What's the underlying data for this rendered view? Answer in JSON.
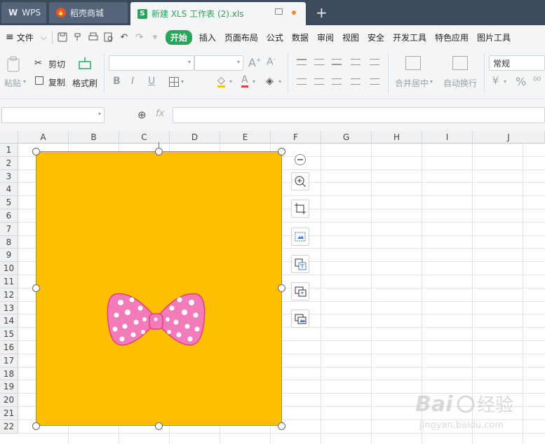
{
  "tabs": {
    "wps": "WPS",
    "shop": "稻壳商城",
    "doc": "新建 XLS 工作表 (2).xls",
    "new_tab": "+"
  },
  "menu": {
    "file": "文件",
    "items": [
      "开始",
      "插入",
      "页面布局",
      "公式",
      "数据",
      "审阅",
      "视图",
      "安全",
      "开发工具",
      "特色应用",
      "图片工具"
    ]
  },
  "ribbon": {
    "paste": "粘贴",
    "cut": "剪切",
    "copy": "复制",
    "format_painter": "格式刷",
    "bold": "B",
    "italic": "I",
    "underline": "U",
    "merge_center": "合并居中",
    "auto_wrap": "自动换行",
    "number_format": "常规",
    "percent": "%"
  },
  "formula_bar": {
    "fx": "fx",
    "name_box": "",
    "formula": ""
  },
  "sheet": {
    "columns": [
      "A",
      "B",
      "C",
      "D",
      "E",
      "F",
      "G",
      "H",
      "I",
      "J"
    ],
    "rows": [
      "1",
      "2",
      "3",
      "4",
      "5",
      "6",
      "7",
      "8",
      "9",
      "10",
      "11",
      "12",
      "13",
      "14",
      "15",
      "16",
      "17",
      "18",
      "19",
      "20",
      "21",
      "22"
    ]
  },
  "picture": {
    "background_color": "#ffbf00",
    "bow_color": "#f47bb9",
    "bow_outline": "#e0407f"
  },
  "side_tools": [
    "zoom-out-icon",
    "zoom-in-icon",
    "crop-icon",
    "picture-fit-icon",
    "picture-translate-icon",
    "picture-add-icon",
    "picture-change-icon"
  ],
  "colors": {
    "accent": "#2aa55c",
    "tabbar": "#3c4a5c"
  }
}
